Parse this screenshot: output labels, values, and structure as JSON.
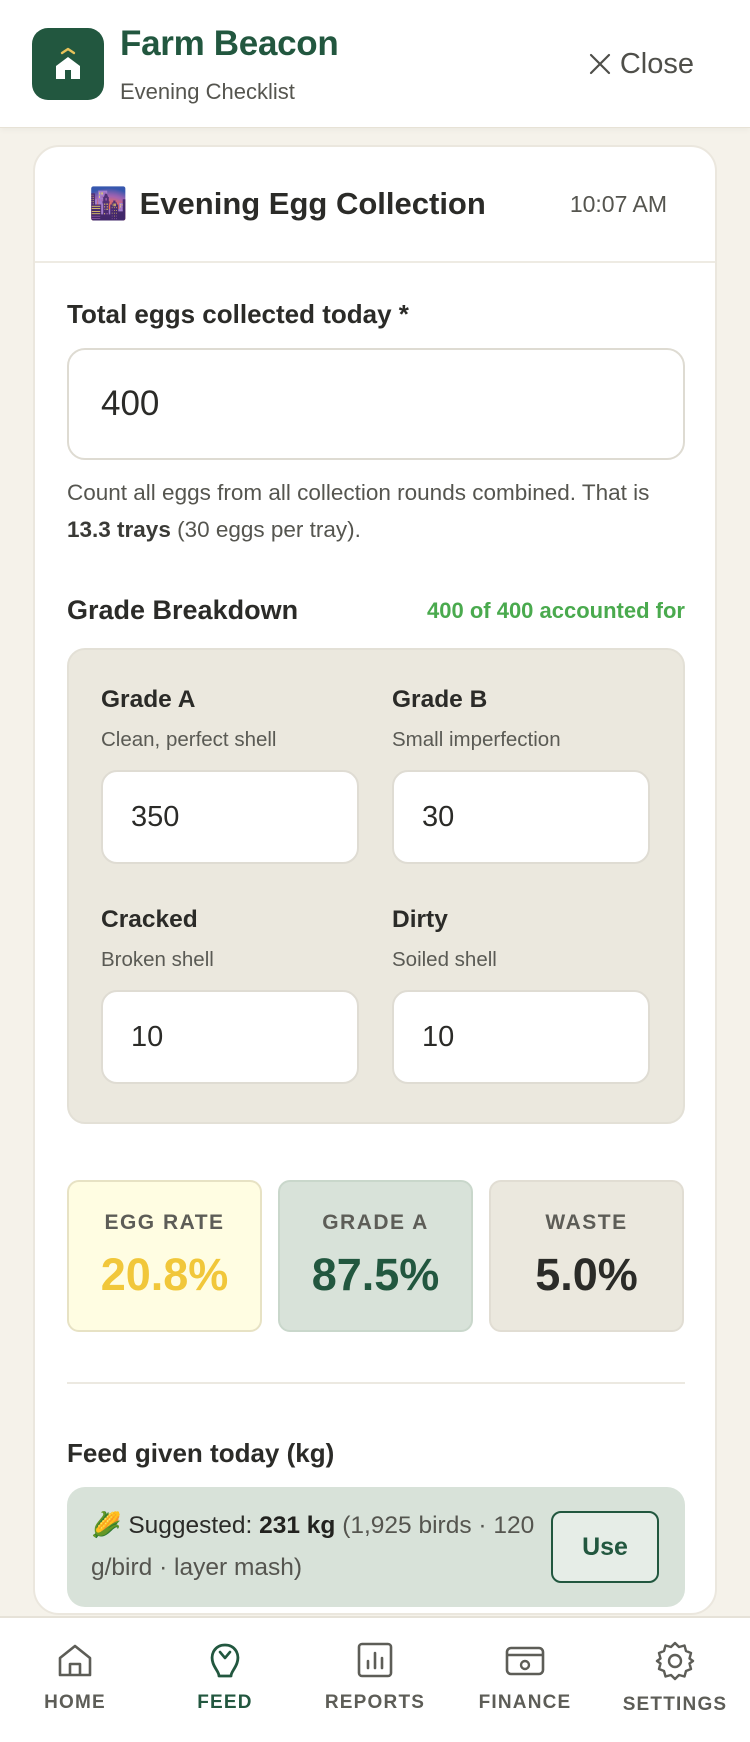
{
  "header": {
    "title": "Farm Beacon",
    "subtitle": "Evening Checklist",
    "close_label": "Close",
    "icons": {
      "logo": "home-icon",
      "close": "close-icon"
    },
    "brand_color": "#22573f"
  },
  "card": {
    "icon": "🌆",
    "title": "Evening Egg Collection",
    "time": "10:07 AM"
  },
  "total_eggs": {
    "label": "Total eggs collected today *",
    "value": "400",
    "hint_prefix": "Count all eggs from all collection rounds combined. That is ",
    "hint_trays": "13.3 trays",
    "hint_suffix": " (30 eggs per tray)."
  },
  "grades": {
    "title": "Grade Breakdown",
    "accounted": "400 of 400 accounted for",
    "accounted_color": "#4aaa4e",
    "items": [
      {
        "name": "Grade A",
        "desc": "Clean, perfect shell",
        "value": "350"
      },
      {
        "name": "Grade B",
        "desc": "Small imperfection",
        "value": "30"
      },
      {
        "name": "Cracked",
        "desc": "Broken shell",
        "value": "10"
      },
      {
        "name": "Dirty",
        "desc": "Soiled shell",
        "value": "10"
      }
    ]
  },
  "stats": [
    {
      "label": "EGG RATE",
      "value": "20.8%",
      "color": "#f1c73a"
    },
    {
      "label": "GRADE A",
      "value": "87.5%",
      "color": "#22573f"
    },
    {
      "label": "WASTE",
      "value": "5.0%",
      "color": "#2b2b28"
    }
  ],
  "feed": {
    "label": "Feed given today (kg)",
    "icon": "🌽",
    "suggested_label": "Suggested: ",
    "suggested_value": "231 kg",
    "suggested_detail": " (1,925 birds · 120 g/bird · layer mash)",
    "use_label": "Use"
  },
  "nav": {
    "active": "FEED",
    "items": [
      {
        "label": "HOME",
        "icon": "home-icon"
      },
      {
        "label": "FEED",
        "icon": "feed-icon"
      },
      {
        "label": "REPORTS",
        "icon": "reports-icon"
      },
      {
        "label": "FINANCE",
        "icon": "finance-icon"
      },
      {
        "label": "SETTINGS",
        "icon": "settings-icon"
      }
    ]
  }
}
